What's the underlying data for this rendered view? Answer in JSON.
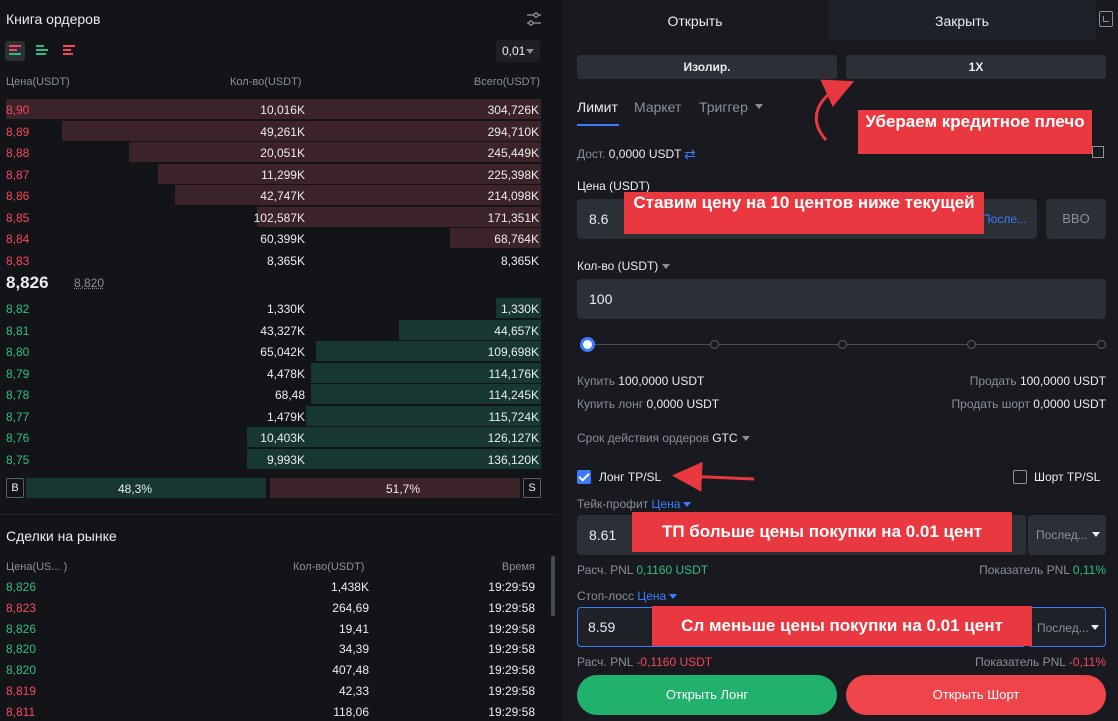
{
  "orderbook": {
    "title": "Книга ордеров",
    "precision": "0,01",
    "columns": {
      "price": "Цена(USDT)",
      "qty": "Кол-во(USDT)",
      "total": "Всего(USDT)"
    },
    "asks": [
      {
        "price": "8,90",
        "qty": "10,016K",
        "total": "304,726K",
        "depth": 1.0
      },
      {
        "price": "8,89",
        "qty": "49,261K",
        "total": "294,710K",
        "depth": 0.895
      },
      {
        "price": "8,88",
        "qty": "20,051K",
        "total": "245,449K",
        "depth": 0.77
      },
      {
        "price": "8,87",
        "qty": "11,299K",
        "total": "225,398K",
        "depth": 0.715
      },
      {
        "price": "8,86",
        "qty": "42,747K",
        "total": "214,098K",
        "depth": 0.685
      },
      {
        "price": "8,85",
        "qty": "102,587K",
        "total": "171,351K",
        "depth": 0.53
      },
      {
        "price": "8,84",
        "qty": "60,399K",
        "total": "68,764K",
        "depth": 0.17
      },
      {
        "price": "8,83",
        "qty": "8,365K",
        "total": "8,365K",
        "depth": 0.0
      }
    ],
    "mid_price": "8,826",
    "mark_price": "8,820",
    "bids": [
      {
        "price": "8,82",
        "qty": "1,330K",
        "total": "1,330K",
        "depth": 0.085
      },
      {
        "price": "8,81",
        "qty": "43,327K",
        "total": "44,657K",
        "depth": 0.265
      },
      {
        "price": "8,80",
        "qty": "65,042K",
        "total": "109,698K",
        "depth": 0.42
      },
      {
        "price": "8,79",
        "qty": "4,478K",
        "total": "114,176K",
        "depth": 0.43
      },
      {
        "price": "8,78",
        "qty": "68,48",
        "total": "114,245K",
        "depth": 0.43
      },
      {
        "price": "8,77",
        "qty": "1,479K",
        "total": "115,724K",
        "depth": 0.44
      },
      {
        "price": "8,76",
        "qty": "10,403K",
        "total": "126,127K",
        "depth": 0.55
      },
      {
        "price": "8,75",
        "qty": "9,993K",
        "total": "136,120K",
        "depth": 0.55
      }
    ],
    "ratio": {
      "b_label": "B",
      "buy_pct": "48,3%",
      "sell_pct": "51,7%",
      "s_label": "S"
    }
  },
  "trades": {
    "title": "Сделки на рынке",
    "columns": {
      "price": "Цена(US... )",
      "qty": "Кол-во(USDT)",
      "time": "Время"
    },
    "rows": [
      {
        "price": "8,826",
        "qty": "1,438K",
        "time": "19:29:59",
        "dir": "up"
      },
      {
        "price": "8,823",
        "qty": "264,69",
        "time": "19:29:58",
        "dir": "down"
      },
      {
        "price": "8,826",
        "qty": "19,41",
        "time": "19:29:58",
        "dir": "up"
      },
      {
        "price": "8,820",
        "qty": "34,39",
        "time": "19:29:58",
        "dir": "up"
      },
      {
        "price": "8,820",
        "qty": "407,48",
        "time": "19:29:58",
        "dir": "up"
      },
      {
        "price": "8,819",
        "qty": "42,33",
        "time": "19:29:58",
        "dir": "down"
      },
      {
        "price": "8,811",
        "qty": "118,06",
        "time": "19:29:58",
        "dir": "down"
      }
    ]
  },
  "trade_panel": {
    "tab_open": "Открыть",
    "tab_close": "Закрыть",
    "margin_mode": "Изолир.",
    "leverage": "1X",
    "order_tabs": [
      "Лимит",
      "Маркет",
      "Триггер"
    ],
    "avail_label": "Дост.",
    "avail_value": "0,0000 USDT",
    "price_label": "Цена (USDT)",
    "price_value": "8.6",
    "price_last": "После...",
    "bbo": "BBO",
    "qty_label": "Кол-во (USDT)",
    "qty_value": "100",
    "slider_level": 0,
    "buy_label": "Купить",
    "buy_value": "100,0000 USDT",
    "sell_label": "Продать",
    "sell_value": "100,0000 USDT",
    "buy_long_label": "Купить лонг",
    "buy_long_value": "0,0000 USDT",
    "sell_short_label": "Продать шорт",
    "sell_short_value": "0,0000 USDT",
    "tif_label": "Срок действия ордеров",
    "tif_value": "GTC",
    "long_tpsl": "Лонг TP/SL",
    "short_tpsl": "Шорт TP/SL",
    "tp_label": "Тейк-профит",
    "tp_type": "Цена",
    "tp_value": "8.61",
    "tp_trigger": "Послед...",
    "tp_pnl_label": "Расч. PNL",
    "tp_pnl_value": "0,1160 USDT",
    "tp_ratio_label": "Показатель PNL",
    "tp_ratio_value": "0,11%",
    "sl_label": "Стоп-лосс",
    "sl_type": "Цена",
    "sl_value": "8.59",
    "sl_trigger": "Послед...",
    "sl_pnl_label": "Расч. PNL",
    "sl_pnl_value": "-0,1160 USDT",
    "sl_ratio_label": "Показатель PNL",
    "sl_ratio_value": "-0,11%",
    "open_long": "Открыть Лонг",
    "open_short": "Открыть Шорт"
  },
  "annotations": {
    "a1": "Убераем кредитное плечо",
    "a2": "Ставим цену на 10 центов ниже текущей",
    "a3": "ТП больше цены покупки на 0.01 цент",
    "a4": "Сл меньше цены покупки на 0.01 цент"
  },
  "colors": {
    "ask": "#f6465d",
    "bid": "#2ebd85",
    "accent": "#3b7cff",
    "annotation": "#e9383f"
  }
}
